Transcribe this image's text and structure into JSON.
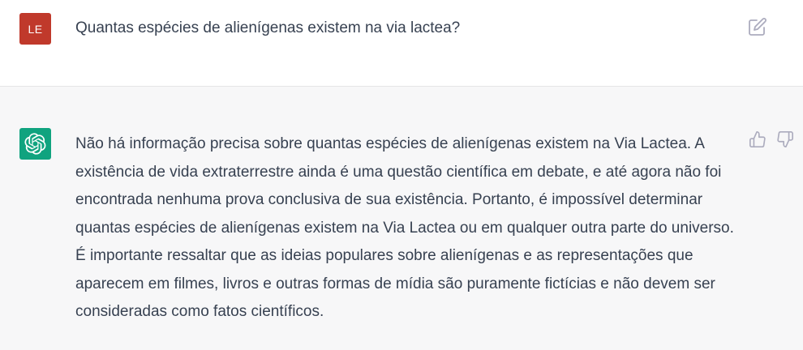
{
  "user_message": {
    "avatar_initials": "LE",
    "avatar_color": "#c0392b",
    "text": "Quantas espécies de alienígenas existem na via lactea?",
    "edit_icon": "edit-icon"
  },
  "assistant_message": {
    "avatar_icon": "openai-logo-icon",
    "avatar_color": "#10a37f",
    "text": "Não há informação precisa sobre quantas espécies de alienígenas existem na Via Lactea. A existência de vida extraterrestre ainda é uma questão científica em debate, e até agora não foi encontrada nenhuma prova conclusiva de sua existência. Portanto, é impossível determinar quantas espécies de alienígenas existem na Via Lactea ou em qualquer outra parte do universo. É importante ressaltar que as ideias populares sobre alienígenas e as representações que aparecem em filmes, livros e outras formas de mídia são puramente fictícias e não devem ser consideradas como fatos científicos.",
    "feedback_icons": [
      "thumbs-up-icon",
      "thumbs-down-icon"
    ]
  },
  "colors": {
    "user_bg": "#ffffff",
    "assistant_bg": "#f7f7f8",
    "text": "#374151",
    "icon": "#acacbe"
  }
}
